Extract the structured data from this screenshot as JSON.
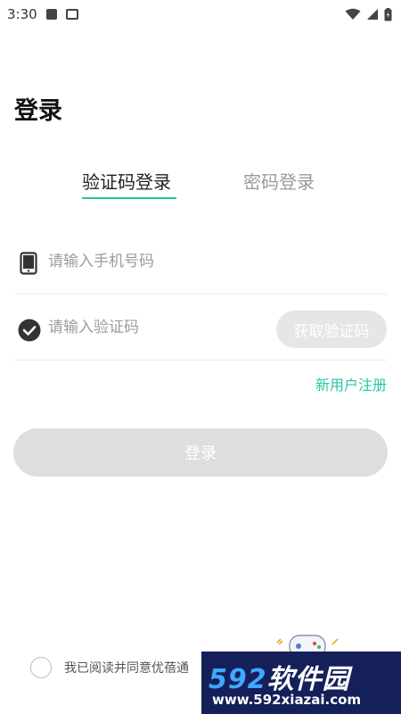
{
  "status_bar": {
    "time": "3:30"
  },
  "header": {
    "title": "登录"
  },
  "tabs": [
    {
      "label": "验证码登录",
      "active": true
    },
    {
      "label": "密码登录",
      "active": false
    }
  ],
  "phone_field": {
    "placeholder": "请输入手机号码",
    "value": ""
  },
  "code_field": {
    "placeholder": "请输入验证码",
    "value": ""
  },
  "get_code_button": {
    "label": "获取验证码"
  },
  "register_link": {
    "label": "新用户注册"
  },
  "login_button": {
    "label": "登录"
  },
  "agreement": {
    "text": "我已阅读并同意优蓓通",
    "checked": false
  },
  "watermark": {
    "brand_number": "592",
    "brand_text": "软件园",
    "url": "www.592xiazai.com"
  },
  "colors": {
    "accent": "#27c7a3",
    "button_disabled": "#dedede",
    "watermark_bg": "#15205a"
  }
}
